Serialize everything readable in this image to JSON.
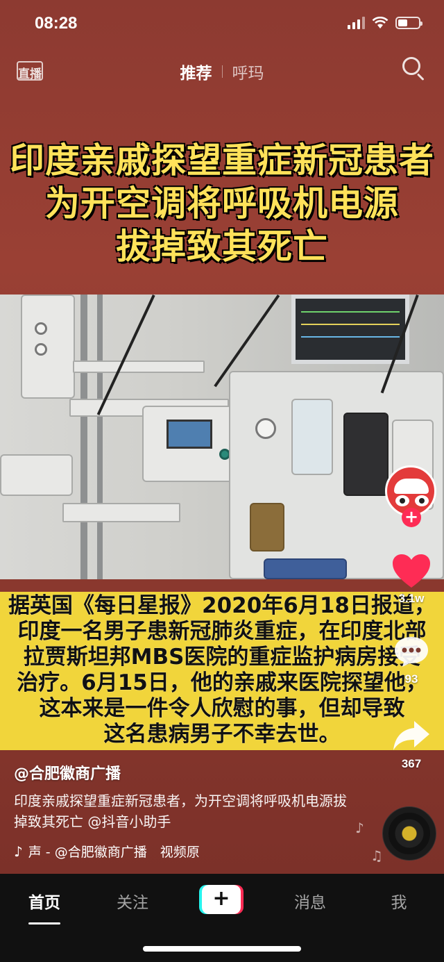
{
  "status_bar": {
    "time": "08:28",
    "battery_level": 0.45
  },
  "top_nav": {
    "live_label": "直播",
    "tabs": [
      {
        "label": "推荐",
        "active": true
      },
      {
        "label": "呼玛",
        "active": false
      }
    ],
    "search_icon": "search-icon"
  },
  "video": {
    "headline": [
      "印度亲戚探望重症新冠患者",
      "为开空调将呼吸机电源",
      "拔掉致其死亡"
    ],
    "caption": [
      "据英国《每日星报》2020年6月18日报道，",
      "印度一名男子患新冠肺炎重症，在印度北部",
      "拉贾斯坦邦MBS医院的重症监护病房接受",
      "治疗。6月15日，他的亲戚来医院探望他，",
      "这本来是一件令人欣慰的事，但却导致",
      "这名患病男子不幸去世。"
    ],
    "headline_color": "#ffe25a",
    "caption_bg": "#f1d53b"
  },
  "rail": {
    "follow_label": "+",
    "likes": "3.1w",
    "comments": "93",
    "shares": "367",
    "like_color": "#fe2c55"
  },
  "info": {
    "author": "@合肥徽商广播",
    "description": "印度亲戚探望重症新冠患者，为开空调将呼吸机电源拔掉致其死亡 @抖音小助手",
    "music": "声 - @合肥徽商广播　视频原"
  },
  "bottom_nav": {
    "home": "首页",
    "following": "关注",
    "create": "+",
    "messages": "消息",
    "me": "我"
  }
}
